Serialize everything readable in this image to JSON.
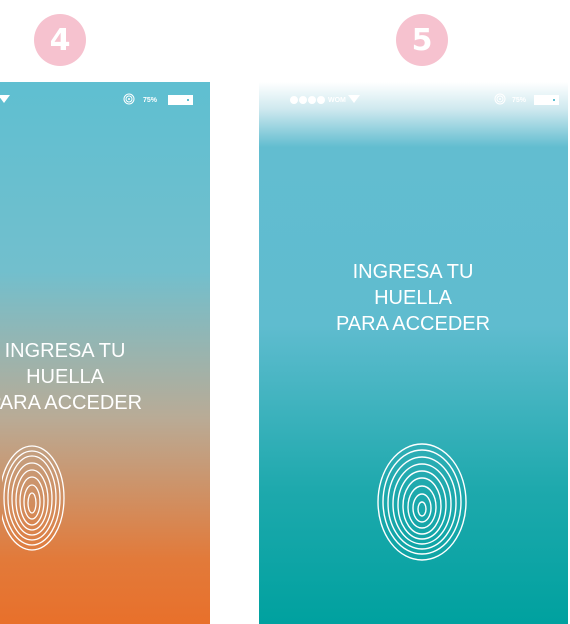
{
  "steps": [
    {
      "number": "4",
      "status": {
        "carrier": "",
        "battery_percent": "75%"
      },
      "prompt": {
        "line1": "INGRESA TU",
        "line2": "HUELLA",
        "line3": "PARA ACCEDER"
      }
    },
    {
      "number": "5",
      "status": {
        "carrier": "WOM",
        "battery_percent": "75%"
      },
      "prompt": {
        "line1": "INGRESA TU",
        "line2": "HUELLA",
        "line3": "PARA ACCEDER"
      }
    }
  ],
  "icons": {
    "signal": "signal-dots-icon",
    "wifi": "wifi-icon",
    "status_fingerprint": "fingerprint-icon",
    "battery": "battery-icon",
    "fingerprint_scanner": "fingerprint-scanner-icon"
  },
  "colors": {
    "badge": "#f6c2cf",
    "screen4_top": "#5fbfd1",
    "screen4_bottom": "#e8702b",
    "screen5_top": "#62bdd0",
    "screen5_bottom": "#00a19f",
    "text": "#ffffff"
  }
}
